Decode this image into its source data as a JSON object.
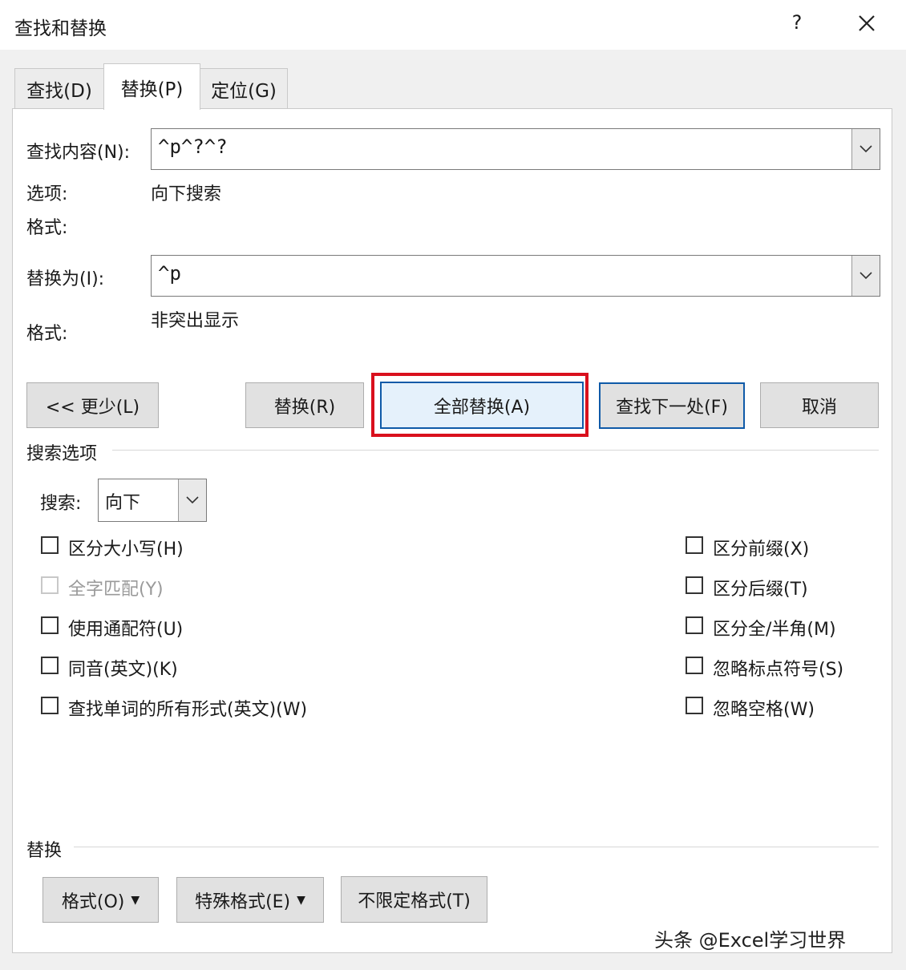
{
  "window": {
    "title": "查找和替换",
    "help": "?",
    "close_icon": "close-icon"
  },
  "tabs": [
    {
      "label": "查找(D)",
      "active": false
    },
    {
      "label": "替换(P)",
      "active": true
    },
    {
      "label": "定位(G)",
      "active": false
    }
  ],
  "find": {
    "label": "查找内容(N):",
    "value": "^p^?^?"
  },
  "options": {
    "label": "选项:",
    "value": "向下搜索"
  },
  "find_format": {
    "label": "格式:"
  },
  "replace": {
    "label": "替换为(I):",
    "value": "^p"
  },
  "replace_format": {
    "label": "格式:",
    "value": "非突出显示"
  },
  "buttons": {
    "less": "<< 更少(L)",
    "replace": "替换(R)",
    "replace_all": "全部替换(A)",
    "find_next": "查找下一处(F)",
    "cancel": "取消"
  },
  "search_options": {
    "title": "搜索选项",
    "search_label": "搜索:",
    "search_value": "向下",
    "left": [
      {
        "label": "区分大小写(H)",
        "checked": false,
        "disabled": false
      },
      {
        "label": "全字匹配(Y)",
        "checked": false,
        "disabled": true
      },
      {
        "label": "使用通配符(U)",
        "checked": false,
        "disabled": false
      },
      {
        "label": "同音(英文)(K)",
        "checked": false,
        "disabled": false
      },
      {
        "label": "查找单词的所有形式(英文)(W)",
        "checked": false,
        "disabled": false
      }
    ],
    "right": [
      {
        "label": "区分前缀(X)",
        "checked": false
      },
      {
        "label": "区分后缀(T)",
        "checked": false
      },
      {
        "label": "区分全/半角(M)",
        "checked": false
      },
      {
        "label": "忽略标点符号(S)",
        "checked": false
      },
      {
        "label": "忽略空格(W)",
        "checked": false
      }
    ]
  },
  "replace_section": {
    "title": "替换",
    "format_button": "格式(O)",
    "special_button": "特殊格式(E)",
    "no_format_button": "不限定格式(T)"
  },
  "watermark": "头条 @Excel学习世界",
  "colors": {
    "highlight": "#d9101d",
    "focus_blue": "#0f5aa8",
    "button_face": "#e1e1e1"
  }
}
